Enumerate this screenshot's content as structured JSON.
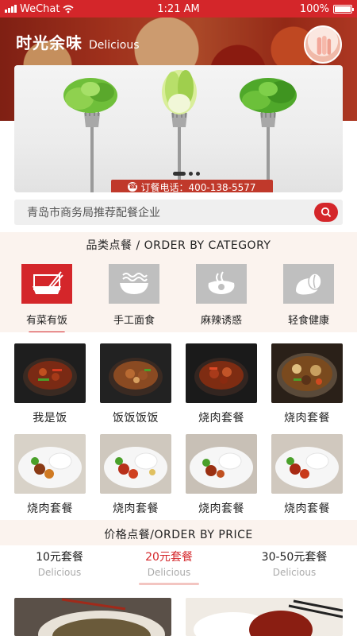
{
  "status_bar": {
    "carrier": "WeChat",
    "time": "1:21 AM",
    "battery": "100%"
  },
  "header": {
    "title_cn": "时光余味",
    "title_en": "Delicious"
  },
  "hero": {
    "phone_text": "订餐电话：400-138-5577",
    "active_slide": 1,
    "slide_count": 3
  },
  "search": {
    "placeholder": "青岛市商务局推荐配餐企业"
  },
  "category_section": {
    "title": "品类点餐 / ORDER BY CATEGORY",
    "items": [
      {
        "label": "有菜有饭",
        "icon": "rice-bowl-chopsticks-icon",
        "active": true
      },
      {
        "label": "手工面食",
        "icon": "noodle-bowl-icon",
        "active": false
      },
      {
        "label": "麻辣诱惑",
        "icon": "spicy-pot-icon",
        "active": false
      },
      {
        "label": "轻食健康",
        "icon": "light-food-icon",
        "active": false
      }
    ]
  },
  "dishes": [
    {
      "label": "我是饭"
    },
    {
      "label": "饭饭饭饭"
    },
    {
      "label": "烧肉套餐"
    },
    {
      "label": "烧肉套餐"
    },
    {
      "label": "烧肉套餐"
    },
    {
      "label": "烧肉套餐"
    },
    {
      "label": "烧肉套餐"
    },
    {
      "label": "烧肉套餐"
    }
  ],
  "price_section": {
    "title": "价格点餐/ORDER BY PRICE",
    "tabs": [
      {
        "label": "10元套餐",
        "sub": "Delicious",
        "active": false
      },
      {
        "label": "20元套餐",
        "sub": "Delicious",
        "active": true
      },
      {
        "label": "30-50元套餐",
        "sub": "Delicious",
        "active": false
      }
    ]
  },
  "colors": {
    "accent": "#d4262a",
    "category_inactive": "#bfbfbf",
    "section_band": "#fbf3ee"
  }
}
